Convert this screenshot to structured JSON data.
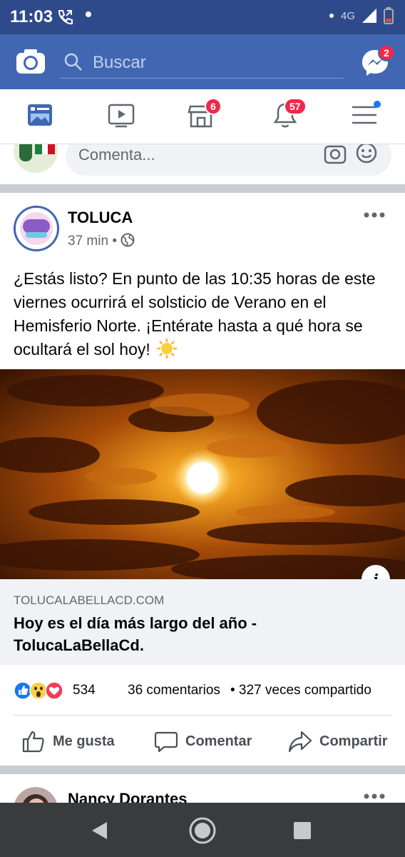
{
  "status_bar": {
    "time": "11:03",
    "network": "4G"
  },
  "top_bar": {
    "search_placeholder": "Buscar",
    "messenger_badge": "2"
  },
  "nav_tabs": {
    "marketplace_badge": "6",
    "notifications_badge": "57"
  },
  "comment_row": {
    "placeholder": "Comenta..."
  },
  "post": {
    "author": "TOLUCA",
    "time": "37 min",
    "separator": "•",
    "text": "¿Estás listo? En punto de las 10:35 horas de este viernes ocurrirá el solsticio de Verano en el Hemisferio Norte. ¡Entérate hasta a qué hora se ocultará el sol hoy!",
    "link_domain": "TOLUCALABELLACD.COM",
    "link_title": "Hoy es el día más largo del año - TolucaLaBellaCd.",
    "reaction_count": "534",
    "comments_count": "36 comentarios",
    "shares_count": "• 327 veces compartido",
    "actions": {
      "like": "Me gusta",
      "comment": "Comentar",
      "share": "Compartir"
    }
  },
  "next_post": {
    "author": "Nancy Dorantes"
  },
  "colors": {
    "brand": "#4267b2",
    "status_bar": "#2f4a8a",
    "badge": "#f02849"
  }
}
